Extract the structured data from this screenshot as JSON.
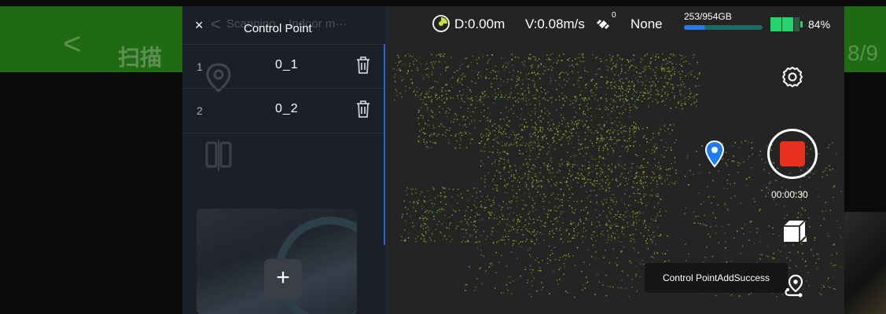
{
  "background_app": {
    "title": "扫描",
    "right_text": "8/9"
  },
  "panel": {
    "close_label": "×",
    "ghost_title": "Scanning... Indoor m···",
    "title": "Control Point",
    "items": [
      {
        "index": "1",
        "name": "0_1"
      },
      {
        "index": "2",
        "name": "0_2"
      }
    ],
    "add_label": "+"
  },
  "status": {
    "distance": "D:0.00m",
    "velocity": "V:0.08m/s",
    "satellites": "0",
    "rtk": "None",
    "storage": "253/954GB",
    "storage_used_fraction": 0.265,
    "battery": "84%",
    "battery_level": 0.84
  },
  "controls": {
    "timer": "00:00:30"
  },
  "toast": "Control PointAddSuccess",
  "colors": {
    "accent_blue": "#2a63c9",
    "record_red": "#e8301e",
    "battery_green": "#22d46a",
    "cloud_green": "#8bd22a"
  },
  "icons": [
    "close-icon",
    "trash-icon",
    "settings-gear-icon",
    "record-stop-icon",
    "cube-view-icon",
    "route-pin-icon",
    "location-pin-icon",
    "satellite-icon",
    "distance-icon"
  ]
}
